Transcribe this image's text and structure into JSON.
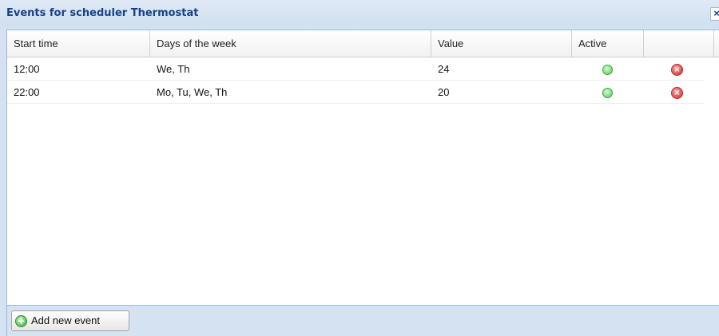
{
  "window": {
    "title": "Events for scheduler Thermostat",
    "close_glyph": "×"
  },
  "grid": {
    "columns": [
      "Start time",
      "Days of the week",
      "Value",
      "Active",
      ""
    ],
    "rows": [
      {
        "start_time": "12:00",
        "days": "We, Th",
        "value": "24",
        "active": true
      },
      {
        "start_time": "22:00",
        "days": "Mo, Tu, We, Th",
        "value": "20",
        "active": true
      }
    ]
  },
  "icons": {
    "active": "active-status-icon",
    "delete": "delete-icon",
    "delete_glyph": "×",
    "add": "add-icon",
    "add_glyph": "+"
  },
  "footer": {
    "add_button_label": "Add new event"
  },
  "colors": {
    "title": "#15428b",
    "frame": "#d5e2f2",
    "border": "#99bbe8",
    "active_green": "#8ee08e",
    "delete_red": "#e25f5f"
  }
}
